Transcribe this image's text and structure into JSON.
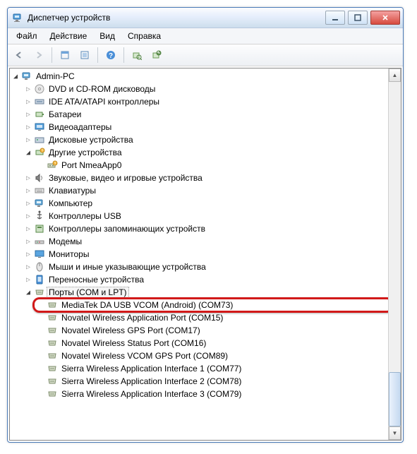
{
  "window": {
    "title": "Диспетчер устройств"
  },
  "menu": {
    "file": "Файл",
    "action": "Действие",
    "view": "Вид",
    "help": "Справка"
  },
  "tree": {
    "root": "Admin-PC",
    "items": [
      "DVD и CD-ROM дисководы",
      "IDE ATA/ATAPI контроллеры",
      "Батареи",
      "Видеоадаптеры",
      "Дисковые устройства"
    ],
    "other": {
      "label": "Другие устройства",
      "child": "Port NmeaApp0"
    },
    "items2": [
      "Звуковые, видео и игровые устройства",
      "Клавиатуры",
      "Компьютер",
      "Контроллеры USB",
      "Контроллеры запоминающих устройств",
      "Модемы",
      "Мониторы",
      "Мыши и иные указывающие устройства",
      "Переносные устройства"
    ],
    "ports": {
      "label": "Порты (COM и LPT)",
      "children": [
        "MediaTek DA USB VCOM (Android) (COM73)",
        "Novatel Wireless Application Port (COM15)",
        "Novatel Wireless GPS Port (COM17)",
        "Novatel Wireless Status Port (COM16)",
        "Novatel Wireless VCOM GPS Port (COM89)",
        "Sierra Wireless Application Interface 1 (COM77)",
        "Sierra Wireless Application Interface 2 (COM78)",
        "Sierra Wireless Application Interface 3 (COM79)"
      ]
    }
  }
}
